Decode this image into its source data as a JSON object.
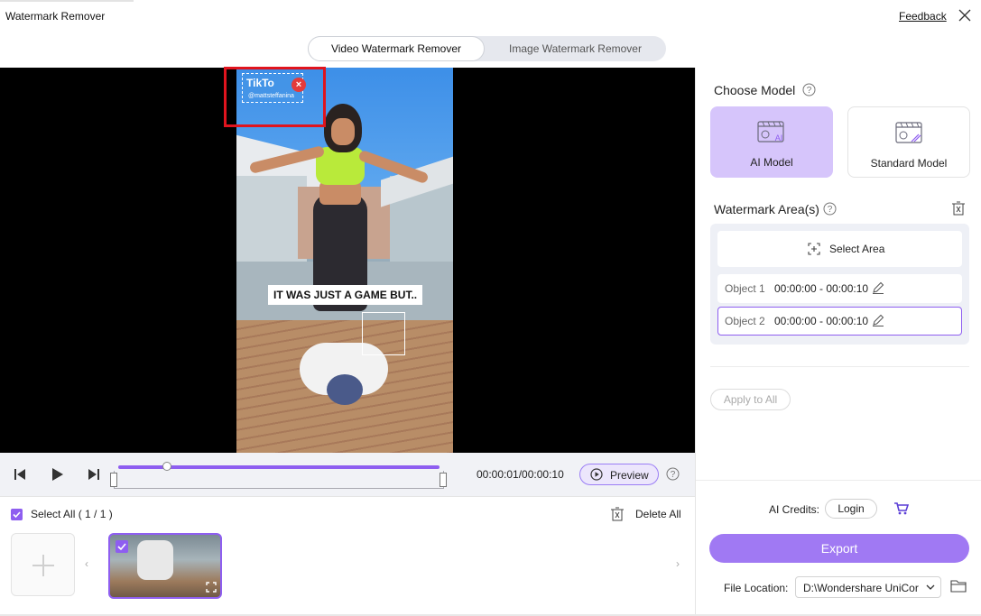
{
  "window": {
    "title": "Watermark Remover",
    "feedback_label": "Feedback"
  },
  "mode_tabs": {
    "video_label": "Video Watermark Remover",
    "image_label": "Image Watermark Remover",
    "active": "video"
  },
  "player": {
    "caption": "IT WAS JUST A GAME BUT..",
    "watermark_brand": "TikTo",
    "watermark_handle": "@mattsteffanina",
    "watermark_overlay": "TikTo"
  },
  "playback": {
    "current_time": "00:00:01",
    "total_time": "00:00:10",
    "time_readout": "00:00:01/00:00:10",
    "preview_label": "Preview",
    "progress_fraction": 0.1
  },
  "media_list": {
    "select_all_label": "Select All ( 1 / 1 )",
    "delete_all_label": "Delete All"
  },
  "model": {
    "title": "Choose Model",
    "options": [
      {
        "label": "AI Model",
        "selected": true
      },
      {
        "label": "Standard Model",
        "selected": false
      }
    ]
  },
  "areas": {
    "title": "Watermark Area(s)",
    "select_area_label": "Select Area",
    "objects": [
      {
        "name": "Object 1",
        "range": "00:00:00 - 00:00:10",
        "selected": false
      },
      {
        "name": "Object 2",
        "range": "00:00:00 - 00:00:10",
        "selected": true
      }
    ],
    "apply_all_label": "Apply to All"
  },
  "footer": {
    "credits_label": "AI Credits:",
    "login_label": "Login",
    "export_label": "Export",
    "file_location_label": "File Location:",
    "file_location_value": "D:\\Wondershare UniCor"
  },
  "colors": {
    "accent": "#8e5ef0",
    "accent_light": "#d6c5fb",
    "export_bg": "#a079f3",
    "highlight_red": "#e0141e"
  }
}
